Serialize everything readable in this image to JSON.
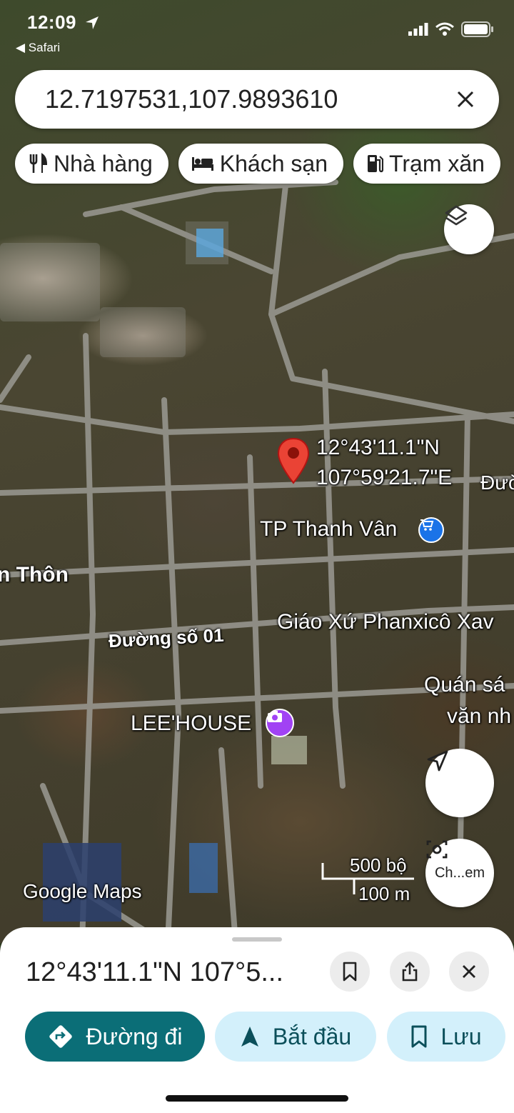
{
  "status_bar": {
    "time": "12:09",
    "back_label": "◀ Safari"
  },
  "search": {
    "value": "12.7197531,107.9893610",
    "clear_icon": "close-icon"
  },
  "chips": [
    {
      "label": "Nhà hàng",
      "icon": "utensils-icon"
    },
    {
      "label": "Khách sạn",
      "icon": "bed-icon"
    },
    {
      "label": "Trạm xăn",
      "icon": "fuel-icon"
    }
  ],
  "map": {
    "pin_lat": "12°43'11.1\"N",
    "pin_lng": "107°59'21.7\"E",
    "labels": {
      "thanh_van": "TP Thanh Vân",
      "thon": "n Thôn",
      "duong_so_01": "Đường số 01",
      "giao_xu": "Giáo Xứ Phanxicô Xav",
      "quan_sa": "Quán sá",
      "van_nh": "văn nh",
      "lee_house": "LEE'HOUSE",
      "duo": "Đườ"
    },
    "scale_bar": {
      "feet": "500 bộ",
      "meters": "100 m"
    },
    "watermark": "Google Maps",
    "lens_label": "Ch...em",
    "poi_shop_color": "#1a73e8",
    "poi_camera_color": "#a142f4",
    "pin_color": "#ea4335"
  },
  "sheet": {
    "title": "12°43'11.1\"N 107°5...",
    "directions_label": "Đường đi",
    "start_label": "Bắt đầu",
    "save_label": "Lưu",
    "accent_color": "#0b6e77",
    "light_button_color": "#d3f0fb"
  }
}
